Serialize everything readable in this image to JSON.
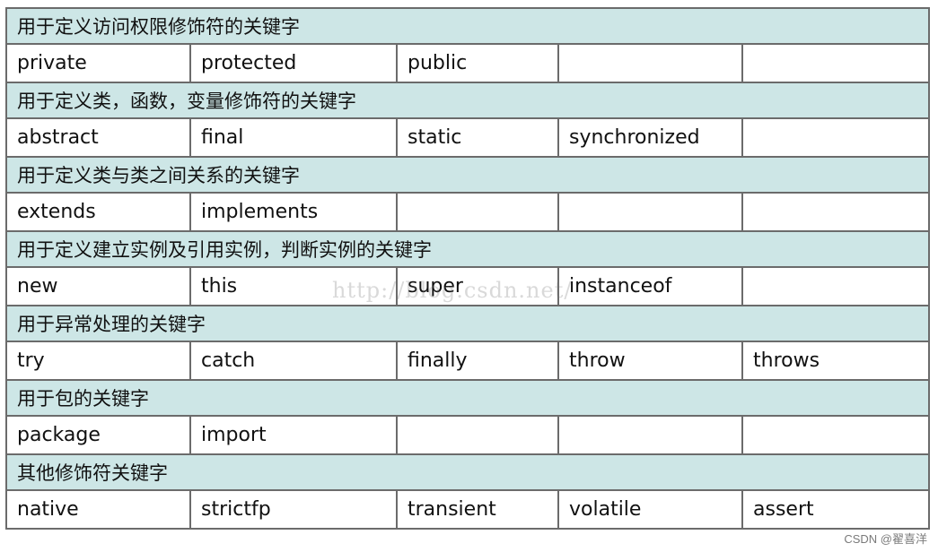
{
  "sections": [
    {
      "title": "用于定义访问权限修饰符的关键字",
      "keywords": [
        "private",
        "protected",
        "public",
        "",
        ""
      ]
    },
    {
      "title": "用于定义类，函数，变量修饰符的关键字",
      "keywords": [
        "abstract",
        "final",
        "static",
        "synchronized",
        ""
      ]
    },
    {
      "title": "用于定义类与类之间关系的关键字",
      "keywords": [
        "extends",
        "implements",
        "",
        "",
        ""
      ]
    },
    {
      "title": "用于定义建立实例及引用实例，判断实例的关键字",
      "keywords": [
        "new",
        "this",
        "super",
        "instanceof",
        ""
      ]
    },
    {
      "title": "用于异常处理的关键字",
      "keywords": [
        "try",
        "catch",
        "finally",
        "throw",
        "throws"
      ]
    },
    {
      "title": "用于包的关键字",
      "keywords": [
        "package",
        "import",
        "",
        "",
        ""
      ]
    },
    {
      "title": "其他修饰符关键字",
      "keywords": [
        "native",
        "strictfp",
        "transient",
        "volatile",
        "assert"
      ]
    }
  ],
  "watermark": "http://blog.csdn.net/",
  "credit": "CSDN @翟喜洋",
  "colors": {
    "category_bg": "#cde6e6",
    "border": "#6b6b6b"
  }
}
